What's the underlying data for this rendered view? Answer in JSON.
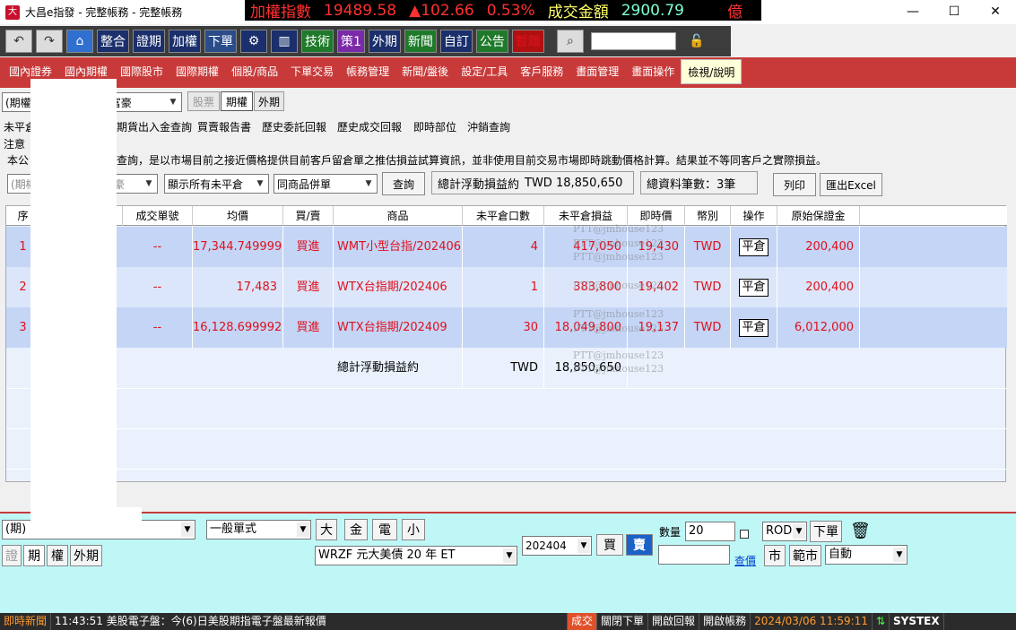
{
  "window": {
    "title": "大昌e指發 - 完整帳務 - 完整帳務"
  },
  "ticker": {
    "label": "加權指數",
    "value": "19489.58",
    "change": "▲102.66",
    "pct": "0.53%",
    "amount_label": "成交金額",
    "amount": "2900.79",
    "unit": "億"
  },
  "toolbar": {
    "buttons": [
      "整合",
      "證期",
      "加權",
      "下單",
      "技術",
      "策1",
      "外期",
      "新聞",
      "自訂",
      "公告",
      "暫離"
    ]
  },
  "menu": [
    "國內證券",
    "國內期權",
    "國際股市",
    "國際期權",
    "個股/商品",
    "下單交易",
    "帳務管理",
    "新聞/盤後",
    "設定/工具",
    "客戶服務",
    "畫面管理",
    "畫面操作",
    "檢視/說明"
  ],
  "account": {
    "select_left": "(期權",
    "select_right": "富豪",
    "tabs": [
      "股票",
      "期權",
      "外期"
    ]
  },
  "subtabs": [
    "未平倉",
    "期貨出入金查詢",
    "買賣報告書",
    "歷史委託回報",
    "歷史成交回報",
    "即時部位",
    "沖銷查詢"
  ],
  "note": {
    "line1": "注意",
    "line2a": "本公",
    "line2b": "查詢，是以市場目前之接近價格提供目前客戶留倉單之推估損益試算資訊，並非使用目前交易市場即時跳動價格計算。結果並不等同客戶之實際損益。"
  },
  "filters": {
    "f1": "(期權",
    "f2": "富豪",
    "f3": "顯示所有未平倉",
    "f4": "同商品併單",
    "query": "查詢",
    "total_label": "總計浮動損益約",
    "total_value": "TWD 18,850,650",
    "count_label": "總資料筆數：",
    "count_value": "3筆",
    "print": "列印",
    "export": "匯出Excel"
  },
  "table": {
    "headers": [
      "序",
      "",
      "成交單號",
      "均價",
      "買/賣",
      "商品",
      "未平倉口數",
      "未平倉損益",
      "即時價",
      "幣別",
      "操作",
      "原始保證金"
    ],
    "rows": [
      {
        "seq": "1",
        "order": "--",
        "avg": "17,344.749999",
        "side": "買進",
        "product": "WMT小型台指/202406",
        "qty": "4",
        "pl": "417,050",
        "price": "19,430",
        "cur": "TWD",
        "op": "平倉",
        "margin": "200,400"
      },
      {
        "seq": "2",
        "order": "--",
        "avg": "17,483",
        "side": "買進",
        "product": "WTX台指期/202406",
        "qty": "1",
        "pl": "383,800",
        "price": "19,402",
        "cur": "TWD",
        "op": "平倉",
        "margin": "200,400"
      },
      {
        "seq": "3",
        "order": "--",
        "avg": "16,128.699992",
        "side": "買進",
        "product": "WTX台指期/202409",
        "qty": "30",
        "pl": "18,049,800",
        "price": "19,137",
        "cur": "TWD",
        "op": "平倉",
        "margin": "6,012,000"
      }
    ],
    "total": {
      "label": "總計浮動損益約",
      "cur": "TWD",
      "value": "18,850,650"
    },
    "watermark": "PTT@jmhouse123"
  },
  "order": {
    "acct": "(期)",
    "type": "一般單式",
    "size_btns": [
      "大",
      "金",
      "電",
      "小"
    ],
    "tabs": [
      "證",
      "期",
      "權",
      "外期"
    ],
    "product": "WRZF  元大美債 20 年 ET",
    "month": "202404",
    "buy": "買",
    "sell": "賣",
    "qty_label": "數量",
    "qty": "20",
    "rod": "ROD",
    "submit": "下單",
    "market": "市",
    "range": "範市",
    "auto": "自動",
    "price_link": "查價"
  },
  "status": {
    "news": "即時新聞",
    "msg": "11:43:51 美股電子盤：今(6)日美股期指電子盤最新報價",
    "deal": "成交",
    "close_order": "關閉下單",
    "open_report": "開啟回報",
    "open_account": "開啟帳務",
    "datetime": "2024/03/06 11:59:11",
    "brand": "SYSTEX"
  }
}
